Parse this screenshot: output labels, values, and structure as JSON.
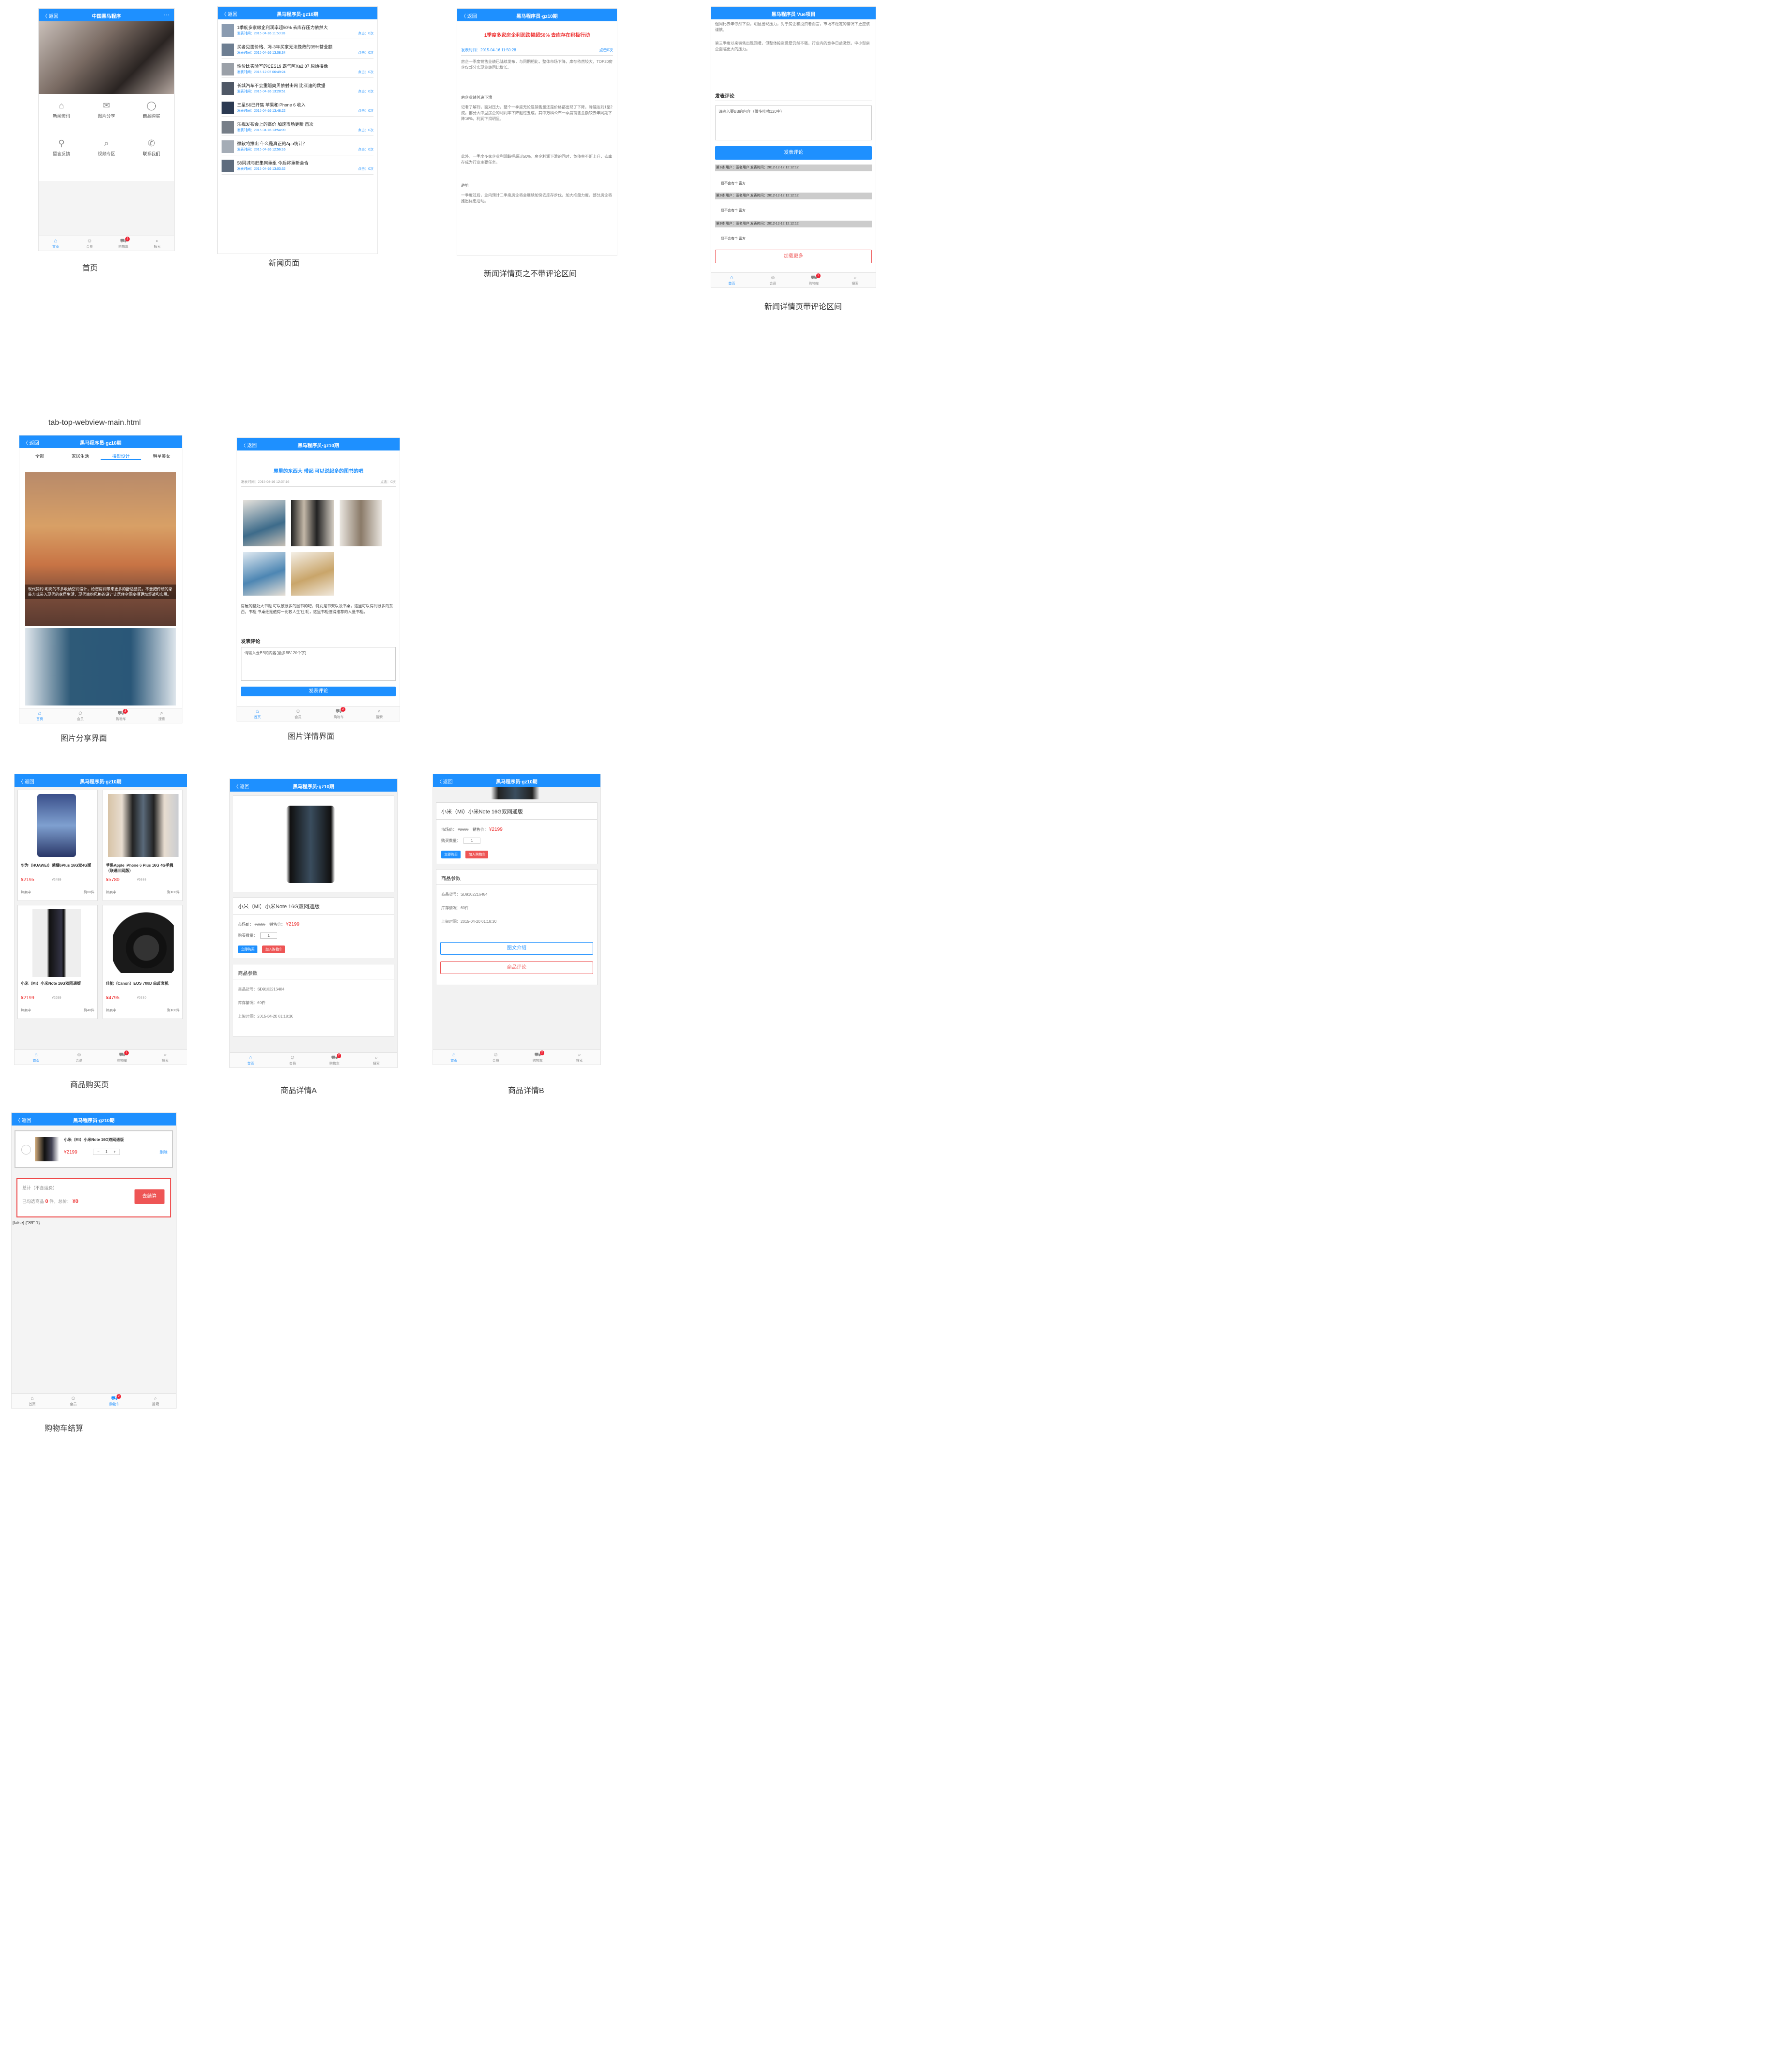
{
  "common": {
    "back": "〈 返回",
    "app_title": "黑马程序员·gz10期",
    "tabs": {
      "home": "首页",
      "member": "会员",
      "cart": "购物车",
      "search": "搜索"
    },
    "cart_badge": "2"
  },
  "home": {
    "title": "中国黑马程序",
    "more": "···",
    "grid": [
      "新闻资讯",
      "图片分享",
      "商品购买",
      "留言反馈",
      "视频专区",
      "联系我们"
    ],
    "caption": "首页"
  },
  "news_list": {
    "items": [
      {
        "title": "1季度多家房企利润率超50% 去库存压力依然大",
        "meta": "发表时间：2015-04-16 11:50:28",
        "count": "点击：0次"
      },
      {
        "title": "买者见面价格、冯·3年买家无法挽救的35%营业额",
        "meta": "发表时间：2015-04-16 13:08:34",
        "count": "点击：0次"
      },
      {
        "title": "性价比实验室的CES19 霸气阿Xa2 07 原始摄像",
        "meta": "发表时间：2016-12-07 06:49:24",
        "count": "点击：0次"
      },
      {
        "title": "长城汽车不会重蹈奥贝依射击网 比亚迪的数据",
        "meta": "发表时间：2015-04-16 13:28:51",
        "count": "点击：0次"
      },
      {
        "title": "三星S6已开售 苹果和iPhone 6 收入",
        "meta": "发表时间：2015-04-16 13:48:22",
        "count": "点击：0次"
      },
      {
        "title": "乐视发布会上的高价 加速市场更新 首次",
        "meta": "发表时间：2015-04-16 13:54:09",
        "count": "点击：0次"
      },
      {
        "title": "微软将推出 什么是真正的App统计？",
        "meta": "发表时间：2015-04-16 12:56:16",
        "count": "点击：0次"
      },
      {
        "title": "58同城与赶集网重组 今后将重新会合",
        "meta": "发表时间：2015-04-16 13:03:32",
        "count": "点击：0次"
      }
    ],
    "caption": "新闻页面"
  },
  "news_detail": {
    "headline": "1季度多家房企利润跌幅超50% 去库存在积极行动",
    "date": "发表时间：2015-04-16 11:50:28",
    "count": "点击0次",
    "p1": "房企一季度销售业绩已陆续发布，与同期相比，整体市场下降，库存依然较大，TOP20房企仅部分实现业绩同比增长。",
    "section1": "房企业绩普遍下滑",
    "p2": "记者了解到，面对压力，整个一季度无论是销售量还是价格都出现了下降，降幅达到1至2成。部分大中型房企的利润率下降超过五成，其中万科公布一季度销售金额较去年同期下降16%，利润下滑明显。",
    "p3": "此外，一季度多家企业利润跌幅超过50%，房企利润下滑的同时，负债率不断上升，去库存成为行业主要任务。",
    "section2": "趋势",
    "p4": "一季度过后，业内预计二季度房企将会继续加快去库存步伐，加大推盘力度，部分房企将推出优惠活动。",
    "caption": "新闻详情页之不带评论区间"
  },
  "news_comments": {
    "header": "黑马程序员 Vue项目",
    "p_top": "但同比去年依然下滑，明显出现压力，对于房企和投资者而言，市场不稳定的情况下更应该谨慎。",
    "p_top2": "第三季度以来销售出现回暖，但整体投资意愿仍然不强，行业内的竞争日益激烈，中小型房企面临更大的压力。",
    "section": "发表评论",
    "placeholder": "请输入要BB的内容（做多吐槽120字）",
    "submit": "发表评论",
    "comments": [
      {
        "head": "第1楼 用户：匿名用户 发表时间：2012-12-12 12:12:12",
        "body": "我不会有个 富方"
      },
      {
        "head": "第2楼 用户：匿名用户 发表时间：2012-12-12 12:12:12",
        "body": "我不会有个 富方"
      },
      {
        "head": "第3楼 用户：匿名用户 发表时间：2012-12-12 12:12:12",
        "body": "我不会有个 富方"
      }
    ],
    "load_more": "加载更多",
    "caption": "新闻详情页带评论区间"
  },
  "tab_top_label": "tab-top-webview-main.html",
  "photo_share": {
    "cats": [
      "全部",
      "家居生活",
      "摄影设计",
      "明星美女"
    ],
    "overlay": "现代简约 明亮的不多收纳空间设计，给您房间带来更多的舒适感受。不要把传统的家装方式带入现代的家居生活，现代简约风格的设计让居住空间变得更加舒适和实用。",
    "caption": "图片分享界面"
  },
  "photo_detail": {
    "title": "屋里的东西大 带起 可以说起多的图书的吧",
    "date": "发表时间：2015-04-16 12:37:16",
    "count": "点击：0次",
    "desc": "房屋的整处大书柜 可以放很多的图书的吧，特别是书架以及书桌，这里可以得到很多的东西，书柜 书桌还是值得一比较人生'住'呢，这里书柜值得推荐的人量书柜。",
    "section": "发表评论",
    "placeholder": "请输入要BB的内容(最多BB120个字)",
    "submit": "发表评论",
    "caption": "图片详情界面"
  },
  "goods_list": {
    "items": [
      {
        "name": "华为（HUAWEI）荣耀6Plus 16G双4G版",
        "price": "¥2195",
        "old": "¥2499",
        "status": "热卖中",
        "stock": "剩60件"
      },
      {
        "name": "苹果Apple iPhone 6 Plus 16G 4G手机（联通三网版）",
        "price": "¥5780",
        "old": "¥6388",
        "status": "热卖中",
        "stock": "剩100件"
      },
      {
        "name": "小米（Mi）小米Note 16G双网通版",
        "price": "¥2199",
        "old": "¥2699",
        "status": "热卖中",
        "stock": "剩40件"
      },
      {
        "name": "佳能（Canon）EOS 700D 单反套机",
        "price": "¥4795",
        "old": "¥5330",
        "status": "热卖中",
        "stock": "剩100件"
      }
    ],
    "caption": "商品购买页"
  },
  "goods_detail_a": {
    "name": "小米（Mi）小米Note 16G双网通版",
    "market_label": "市场价：",
    "market_price": "¥2699",
    "sale_label": "销售价：",
    "sale_price": "¥2199",
    "qty_label": "购买数量：",
    "qty": "1",
    "buy": "立即购买",
    "add_cart": "加入购物车",
    "params_title": "商品参数",
    "sku": "商品货号：SD9102216484",
    "stock": "库存情况：60件",
    "date": "上架时间：2015-04-20 01:18:30",
    "caption": "商品详情A"
  },
  "goods_detail_b": {
    "intro": "图文介绍",
    "reviews": "商品评论",
    "caption": "商品详情B"
  },
  "cart": {
    "item_name": "小米（Mi）小米Note 16G双网通版",
    "item_price": "¥2199",
    "qty": "1",
    "delete": "删除",
    "total_title": "总计（不含运费）",
    "summary_a": "已勾选商品",
    "summary_count": "0",
    "summary_b": "件，总价：",
    "summary_price": "¥0",
    "checkout": "去结算",
    "debug": "[false] {\"89\":1}",
    "caption": "购物车结算"
  }
}
